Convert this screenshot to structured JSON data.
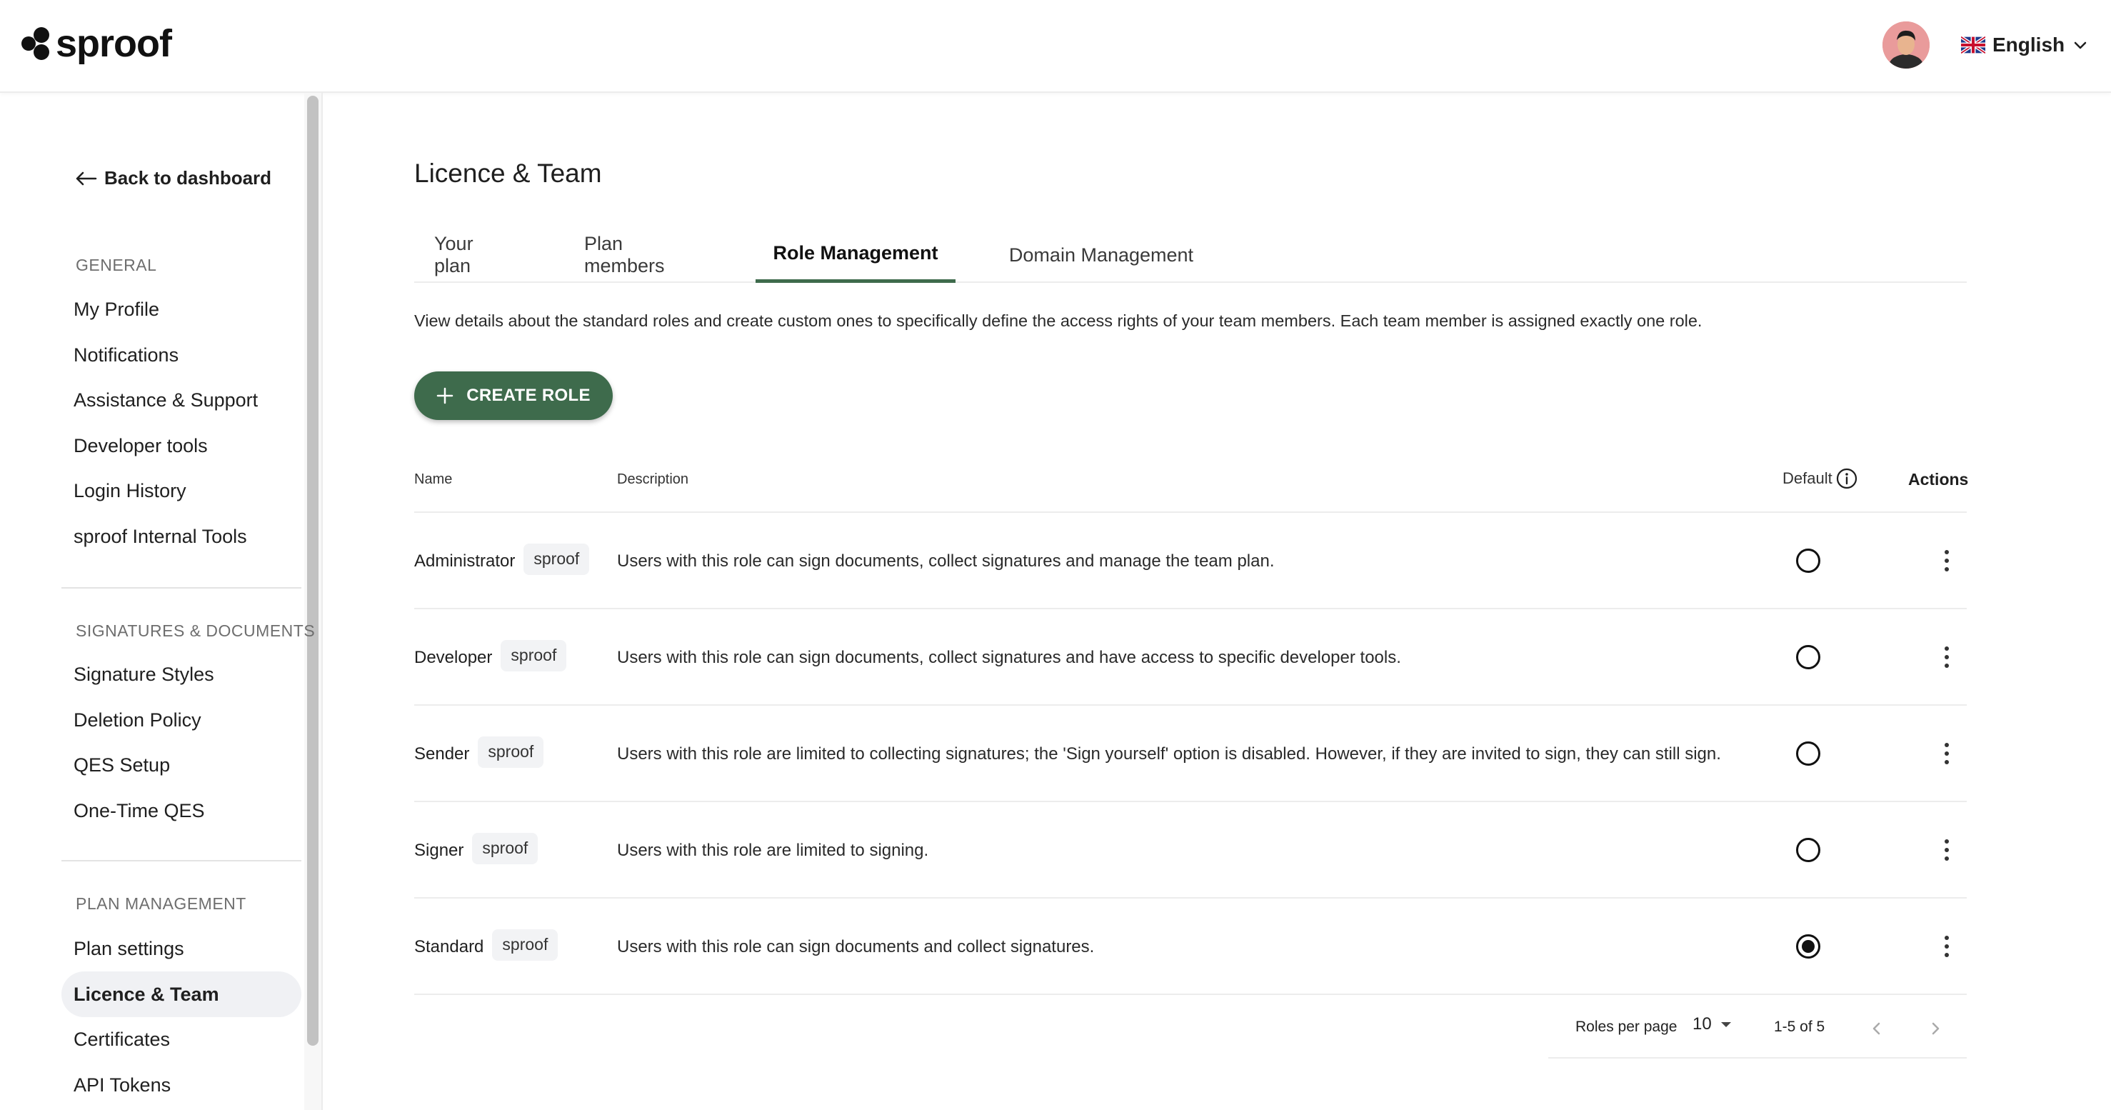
{
  "header": {
    "logo_text": "sproof",
    "language": "English",
    "avatar_icon": "user-avatar"
  },
  "sidebar": {
    "back_label": "Back to dashboard",
    "sections": [
      {
        "title": "GENERAL",
        "items": [
          "My Profile",
          "Notifications",
          "Assistance & Support",
          "Developer tools",
          "Login History",
          "sproof Internal Tools"
        ]
      },
      {
        "title": "SIGNATURES & DOCUMENTS",
        "items": [
          "Signature Styles",
          "Deletion Policy",
          "QES Setup",
          "One-Time QES"
        ]
      },
      {
        "title": "PLAN MANAGEMENT",
        "items": [
          "Plan settings",
          "Licence & Team",
          "Certificates",
          "API Tokens"
        ]
      }
    ],
    "active_item": "Licence & Team"
  },
  "main": {
    "title": "Licence & Team",
    "tabs": [
      {
        "label": "Your plan",
        "active": false
      },
      {
        "label": "Plan members",
        "active": false
      },
      {
        "label": "Role Management",
        "active": true
      },
      {
        "label": "Domain Management",
        "active": false
      }
    ],
    "intro": "View details about the standard roles and create custom ones to specifically define the access rights of your team members. Each team member is assigned exactly one role.",
    "create_button": "CREATE ROLE",
    "table": {
      "columns": {
        "name": "Name",
        "description": "Description",
        "default": "Default",
        "actions": "Actions"
      },
      "rows": [
        {
          "name": "Administrator",
          "badge": "sproof",
          "description": "Users with this role can sign documents, collect signatures and manage the team plan.",
          "default": false
        },
        {
          "name": "Developer",
          "badge": "sproof",
          "description": "Users with this role can sign documents, collect signatures and have access to specific developer tools.",
          "default": false
        },
        {
          "name": "Sender",
          "badge": "sproof",
          "description": "Users with this role are limited to collecting signatures; the 'Sign yourself' option is disabled. However, if they are invited to sign, they can still sign.",
          "default": false
        },
        {
          "name": "Signer",
          "badge": "sproof",
          "description": "Users with this role are limited to signing.",
          "default": false
        },
        {
          "name": "Standard",
          "badge": "sproof",
          "description": "Users with this role can sign documents and collect signatures.",
          "default": true
        }
      ]
    },
    "pagination": {
      "rows_per_page_label": "Roles per page",
      "rows_per_page": "10",
      "range": "1-5 of 5"
    }
  },
  "colors": {
    "accent": "#3e6b4c",
    "active_nav_bg": "#f0f1f4",
    "chip_bg": "#f2f3f5"
  }
}
